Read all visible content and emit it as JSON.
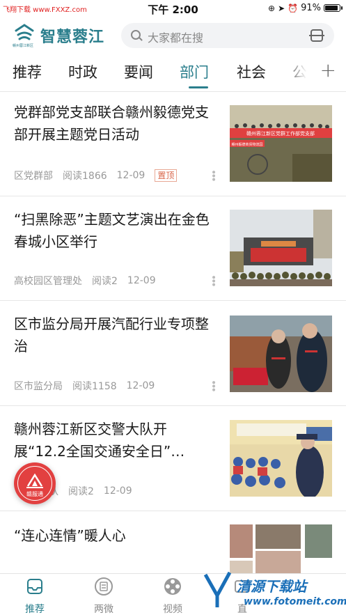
{
  "watermark_top": "飞翔下载 www.FXXZ.com",
  "status": {
    "time": "下午 2:00",
    "battery": "91%",
    "battery_level": 0.91
  },
  "header": {
    "brand": "智慧蓉江",
    "brand_sub": "赣州蓉江新区",
    "search_placeholder": "大家都在搜"
  },
  "tabs": [
    {
      "label": "推荐"
    },
    {
      "label": "时政"
    },
    {
      "label": "要闻"
    },
    {
      "label": "部门",
      "active": true
    },
    {
      "label": "社会"
    },
    {
      "label": "公"
    }
  ],
  "tab_add": "+",
  "news": [
    {
      "title": "党群部党支部联合赣州毅德党支部开展主题党日活动",
      "source": "区党群部",
      "reads": "阅读1866",
      "date": "12-09",
      "badge": "置顶",
      "thumb_banner": "赣州蓉江新区党群工作部党支部",
      "thumb_banner2": "赣州毅德商贸物流园"
    },
    {
      "title": "“扫黑除恶”主题文艺演出在金色春城小区举行",
      "source": "高校园区管理处",
      "reads": "阅读2",
      "date": "12-09"
    },
    {
      "title": "区市监分局开展汽配行业专项整治",
      "source": "区市监分局",
      "reads": "阅读1158",
      "date": "12-09"
    },
    {
      "title": "赣州蓉江新区交警大队开展“12.2全国交通安全日”…",
      "source": "队",
      "reads": "阅读2",
      "date": "12-09"
    },
    {
      "title": "“连心连情”暖人心"
    }
  ],
  "float_button": {
    "label": "赣服通"
  },
  "bottom_nav": [
    {
      "label": "推荐",
      "active": true
    },
    {
      "label": "两微"
    },
    {
      "label": "视频"
    },
    {
      "label": "直"
    }
  ],
  "watermark_bottom": {
    "text": "清源下载站",
    "url": "www.fotomeit.com"
  },
  "colors": {
    "accent": "#2a7e8c",
    "badge": "#d9664a",
    "float": "#e24040"
  }
}
